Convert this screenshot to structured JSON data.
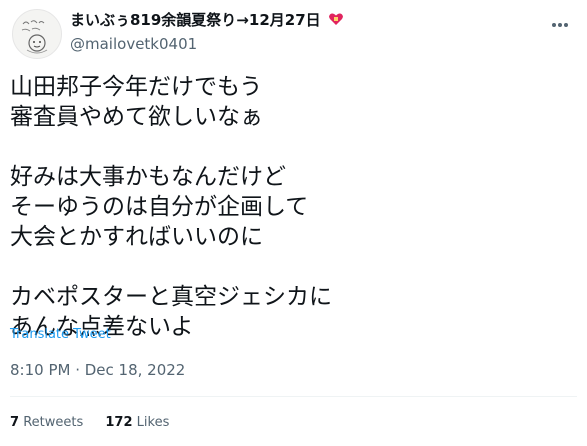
{
  "author": {
    "display_name": "まいぶぅ819余韻夏祭り→12月27日",
    "handle": "@mailovetk0401",
    "avatar_icon": "avatar-sketch-icon",
    "badge_icon": "heart-gift-icon"
  },
  "tweet": {
    "text": "山田邦子今年だけでもう\n審査員やめて欲しいなぁ\n\n好みは大事かもなんだけど\nそーゆうのは自分が企画して\n大会とかすればいいのに\n\nカベポスターと真空ジェシカに\nあんな点差ないよ",
    "translate_label": "Translate Tweet",
    "timestamp": "8:10 PM · Dec 18, 2022"
  },
  "stats": {
    "retweets_count": "7",
    "retweets_label": "Retweets",
    "likes_count": "172",
    "likes_label": "Likes"
  },
  "colors": {
    "link": "#1d9bf0",
    "secondary_text": "#536471",
    "badge": "#e0245e"
  }
}
